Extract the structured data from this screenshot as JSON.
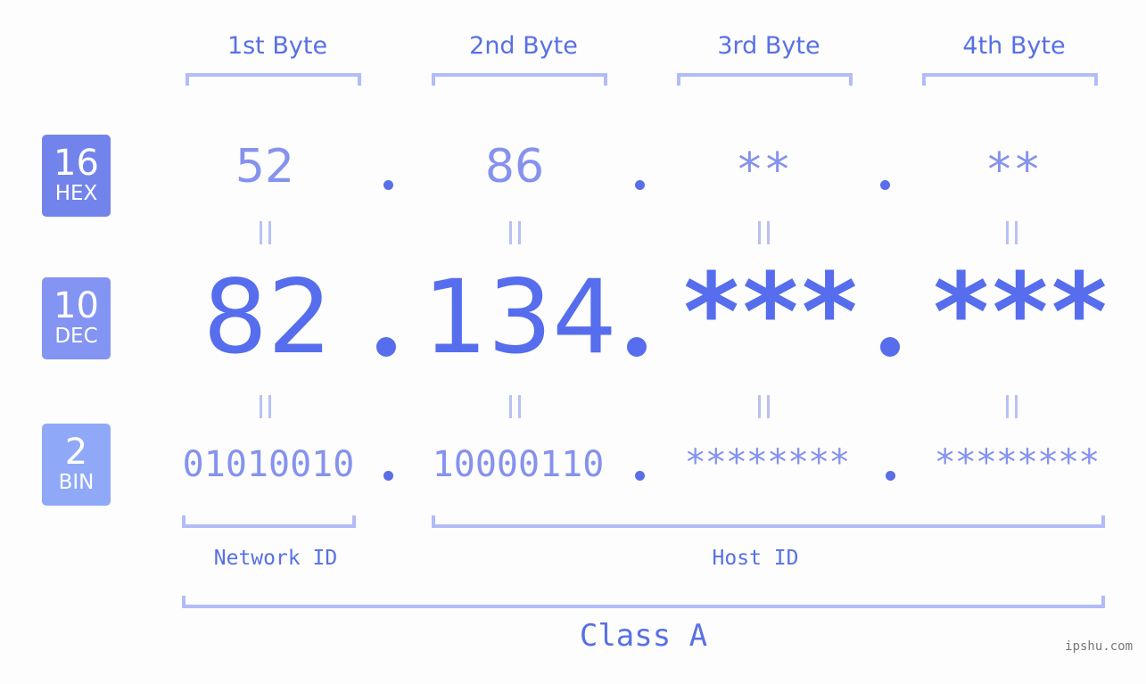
{
  "badges": [
    {
      "number": "16",
      "label": "HEX",
      "color": "#7383ec"
    },
    {
      "number": "10",
      "label": "DEC",
      "color": "#8494f2"
    },
    {
      "number": "2",
      "label": "BIN",
      "color": "#8fa8f8"
    }
  ],
  "bytes": [
    {
      "header": "1st Byte",
      "hex": "52",
      "dec": "82",
      "bin": "01010010"
    },
    {
      "header": "2nd Byte",
      "hex": "86",
      "dec": "134",
      "bin": "10000110"
    },
    {
      "header": "3rd Byte",
      "hex": "**",
      "dec": "***",
      "bin": "********"
    },
    {
      "header": "4th Byte",
      "hex": "**",
      "dec": "***",
      "bin": "********"
    }
  ],
  "labels": {
    "network_id": "Network ID",
    "host_id": "Host ID",
    "class": "Class A"
  },
  "watermark": "ipshu.com",
  "colors": {
    "primary": "#566ded",
    "secondary": "#8592ee",
    "bracket": "#b2bcf8"
  }
}
